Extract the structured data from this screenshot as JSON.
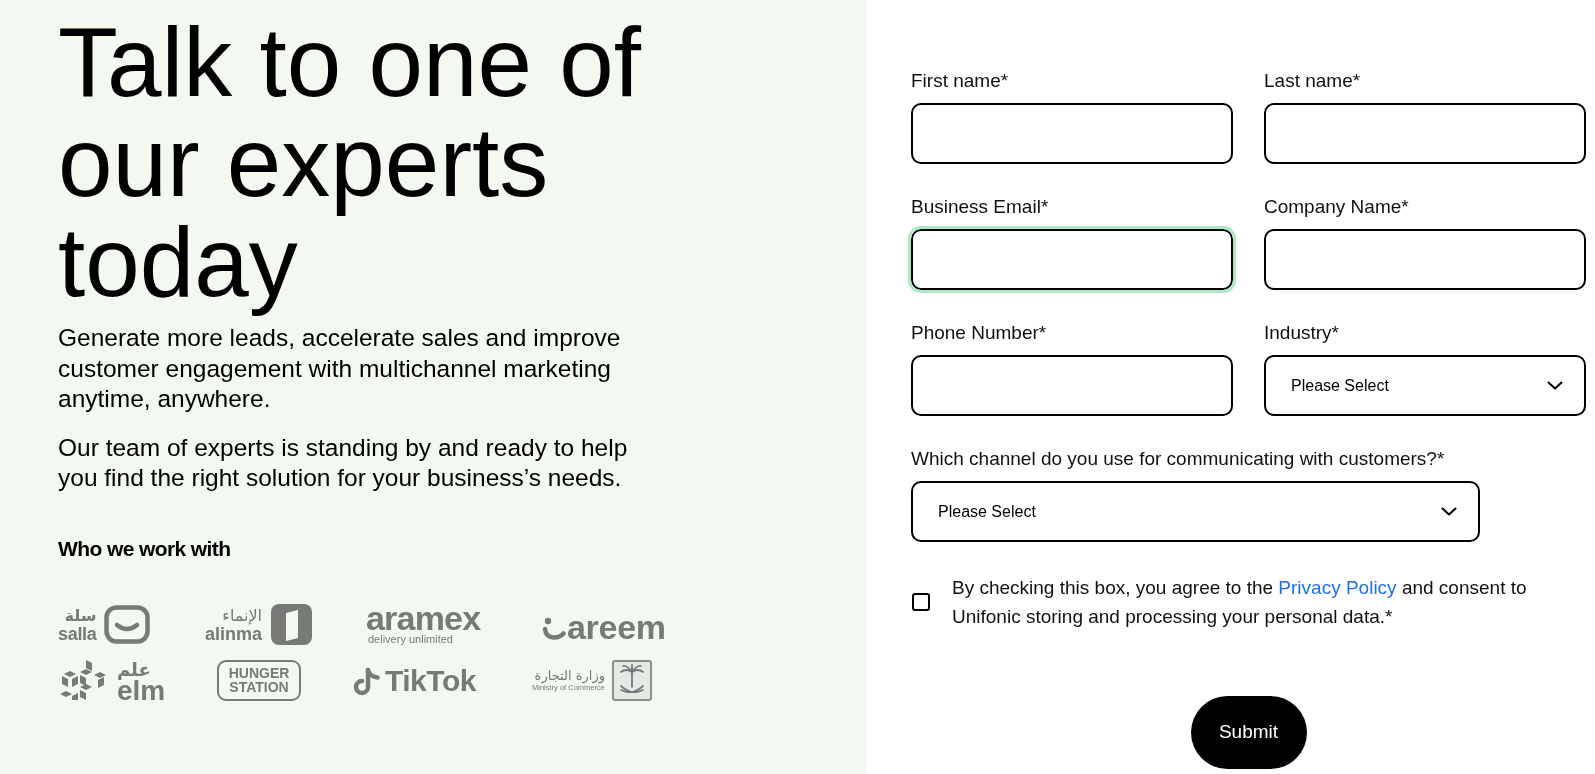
{
  "hero": {
    "title": "Talk to one of our experts today",
    "paragraphs": [
      "Generate more leads, accelerate sales and improve customer engagement with multichannel marketing anytime, anywhere.",
      "Our team of experts is standing by and ready to help you find the right solution for your business’s needs."
    ]
  },
  "clients": {
    "heading": "Who we work with",
    "logos": [
      {
        "kind": "salla",
        "arabic": "سلة",
        "latin": "salla"
      },
      {
        "kind": "alinma",
        "arabic": "الإنماء",
        "latin": "alinma"
      },
      {
        "kind": "aramex",
        "wordmark": "aramex",
        "tagline": "delivery unlimited"
      },
      {
        "kind": "careem",
        "wordmark": "areem"
      },
      {
        "kind": "elm",
        "arabic": "علم",
        "latin": "elm"
      },
      {
        "kind": "hungerstation",
        "wordmark": "HUNGER STATION"
      },
      {
        "kind": "tiktok",
        "wordmark": "TikTok"
      },
      {
        "kind": "ministry",
        "arabic": "وزارة التجارة",
        "latin": "Ministry of Commerce"
      }
    ]
  },
  "form": {
    "rows": [
      [
        {
          "kind": "text",
          "label": "First name*",
          "focused": false
        },
        {
          "kind": "text",
          "label": "Last name*",
          "focused": false
        }
      ],
      [
        {
          "kind": "text",
          "label": "Business Email*",
          "focused": true
        },
        {
          "kind": "text",
          "label": "Company Name*",
          "focused": false
        }
      ],
      [
        {
          "kind": "text",
          "label": "Phone Number*",
          "focused": false
        },
        {
          "kind": "select",
          "label": "Industry*",
          "value": "Please Select",
          "focused": false
        }
      ],
      [
        {
          "kind": "select",
          "label": "Which channel do you use for communicating with customers?*",
          "value": "Please Select",
          "focused": false
        }
      ]
    ],
    "consent": {
      "checked": false,
      "text_before": "By checking this box, you agree to the ",
      "link": "Privacy Policy",
      "text_after": " and consent to Unifonic storing and processing your personal data.*"
    },
    "submit": {
      "label": "Submit"
    }
  }
}
